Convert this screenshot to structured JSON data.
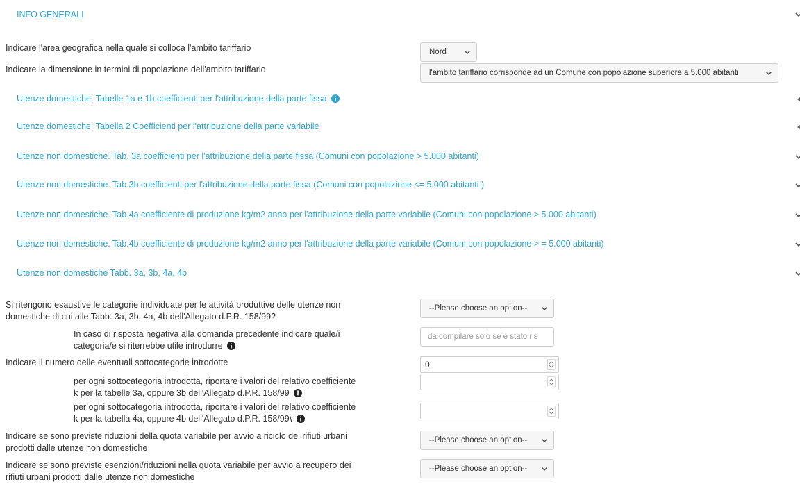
{
  "header": {
    "title": "INFO GENERALI"
  },
  "general": {
    "area_label": "Indicare l'area geografica nella quale si colloca l'ambito tariffario",
    "area_value": "Nord",
    "dimension_label": "Indicare la dimensione in termini di popolazione dell'ambito tariffario",
    "dimension_value": "l'ambito tariffario corrisponde ad un Comune con popolazione superiore a 5.000 abitanti"
  },
  "sections": [
    {
      "label": "Utenze domestiche. Tabelle 1a e 1b coefficienti per l'attribuzione della parte fissa"
    },
    {
      "label": "Utenze domestiche. Tabella 2 Coefficienti per l'attribuzione della parte variabile"
    },
    {
      "label": "Utenze non domestiche. Tab. 3a coefficienti per l'attribuzione della parte fissa (Comuni con popolazione > 5.000 abitanti)"
    },
    {
      "label": "Utenze non domestiche. Tab.3b coefficienti per l'attribuzione della parte fissa (Comuni con popolazione <= 5.000 abitanti )"
    },
    {
      "label": "Utenze non domestiche. Tab.4a coefficiente di produzione kg/m2 anno per l'attribuzione della parte variabile (Comuni con popolazione > 5.000 abitanti)"
    },
    {
      "label": "Utenze non domestiche. Tab.4b coefficiente di produzione kg/m2 anno per l'attribuzione della parte variabile (Comuni con popolazione > = 5.000 abitanti)"
    },
    {
      "label": "Utenze non domestiche Tabb. 3a, 3b, 4a, 4b"
    }
  ],
  "form": {
    "q1_line1": "Si ritengono esaustive le categorie individuate per le attività produttive delle utenze non",
    "q1_line2": "domestiche di cui alle Tabb. 3a, 3b, 4a, 4b dell'Allegato d.P.R. 158/99?",
    "q1_value": "--Please choose an option--",
    "q2_line1": "In caso di risposta negativa alla domanda precedente indicare quale/i",
    "q2_line2": "categoria/e si riterrebbe utile introdurre",
    "q2_placeholder": "da compilare solo se è stato ris",
    "q3_label": "Indicare il numero delle eventuali sottocategorie introdotte",
    "q3_value": "0",
    "q4_line1": "per ogni sottocategoria introdotta, riportare i valori del relativo coefficiente",
    "q4_line2": "k per la tabelle 3a, oppure 3b dell'Allegato d.P.R. 158/99",
    "q5_line1": "per ogni sottocategoria introdotta, riportare i valori del relativo coefficiente",
    "q5_line2": "k per la tabella 4a, oppure 4b dell'Allegato d.P.R. 158/99\\",
    "q6_line1": "Indicare se sono previste riduzioni della quota variabile per avvio a riciclo dei rifiuti urbani",
    "q6_line2": "prodotti dalle utenze non domestiche",
    "q6_value": "--Please choose an option--",
    "q7_line1": "Indicare se sono previste esenzioni/riduzioni nella quota variabile per avvio a recupero dei",
    "q7_line2": "rifiuti urbani prodotti dalle utenze non domestiche",
    "q7_value": "--Please choose an option--"
  },
  "colors": {
    "link": "#2aa7d6",
    "text": "#333333",
    "border": "#cfcfcf"
  }
}
